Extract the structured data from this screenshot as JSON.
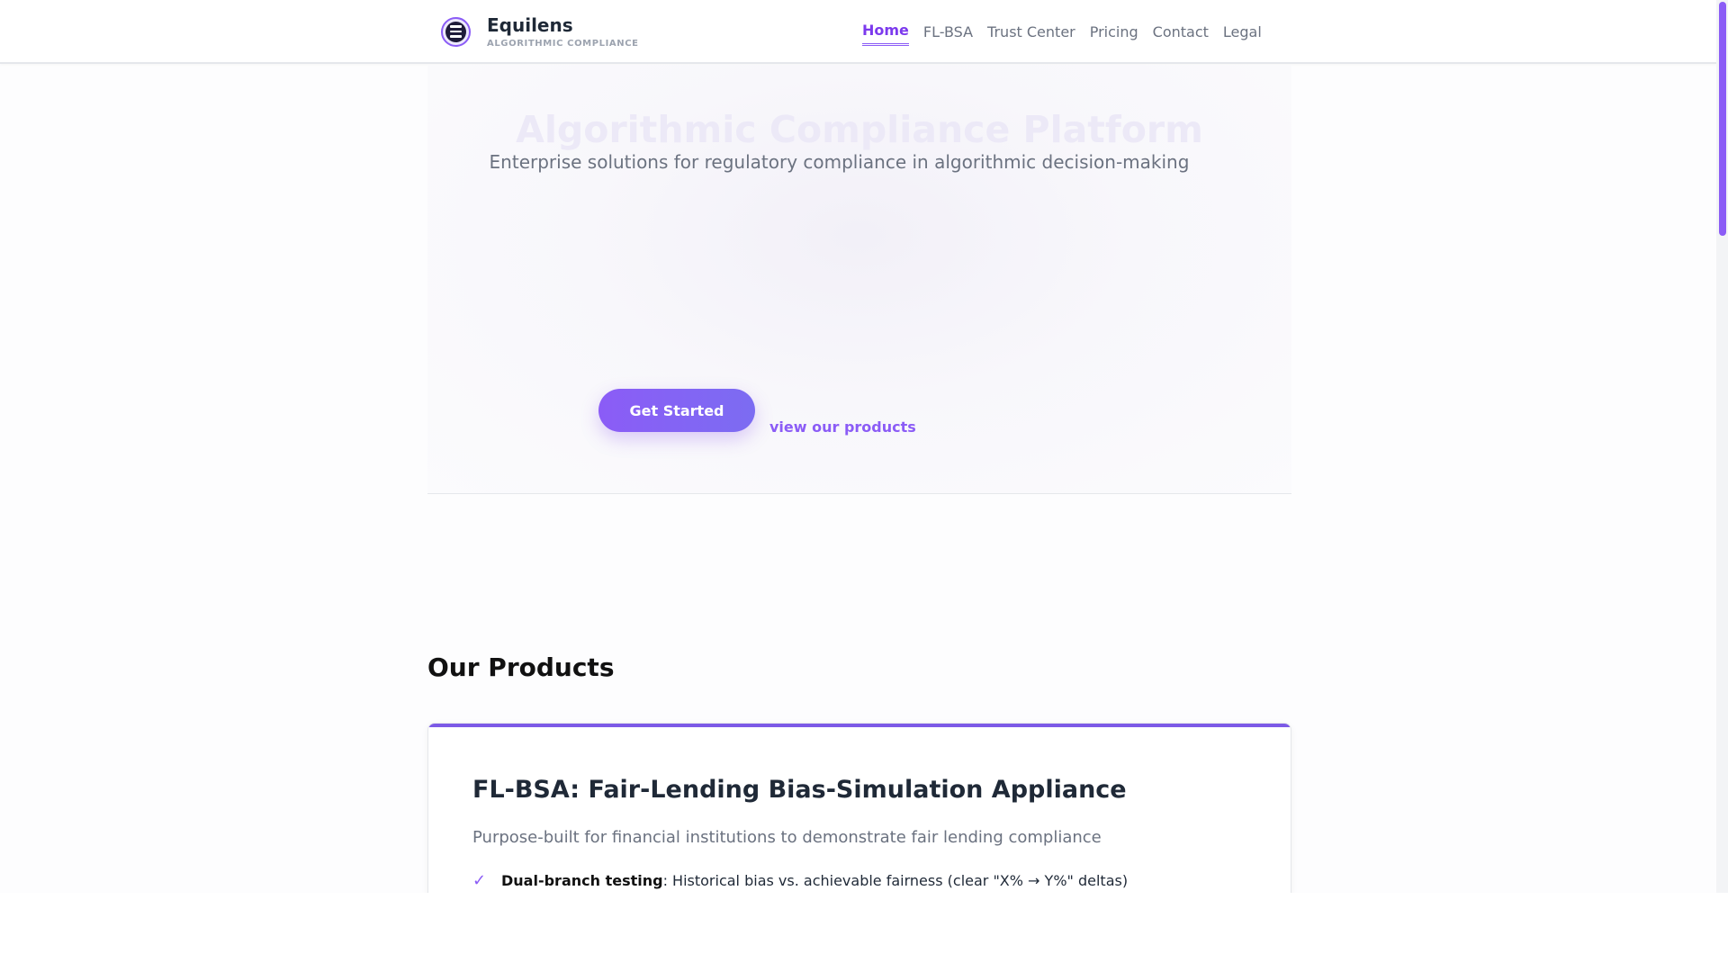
{
  "brand": {
    "name": "Equilens",
    "tagline": "ALGORITHMIC COMPLIANCE"
  },
  "nav": {
    "items": [
      {
        "label": "Home",
        "active": true
      },
      {
        "label": "FL-BSA",
        "active": false
      },
      {
        "label": "Trust Center",
        "active": false
      },
      {
        "label": "Pricing",
        "active": false
      },
      {
        "label": "Contact",
        "active": false
      },
      {
        "label": "Legal",
        "active": false
      }
    ]
  },
  "hero": {
    "title": "Algorithmic Compliance Platform",
    "subtitle": "Enterprise solutions for regulatory compliance in algorithmic decision-making",
    "cta_label": "Get Started",
    "link_label": "view our products"
  },
  "products": {
    "heading": "Our Products",
    "card": {
      "title": "FL-BSA: Fair-Lending Bias-Simulation Appliance",
      "description": "Purpose-built for financial institutions to demonstrate fair lending compliance",
      "features": [
        {
          "title": "Dual-branch testing",
          "text": ": Historical bias vs. achievable fairness (clear \"X% → Y%\" deltas)"
        }
      ]
    }
  },
  "colors": {
    "accent": "#8b5cf6",
    "text": "#1f2937",
    "muted": "#6b7280"
  },
  "icons": {
    "logo": "equilens-logo-icon",
    "check": "check-icon"
  }
}
